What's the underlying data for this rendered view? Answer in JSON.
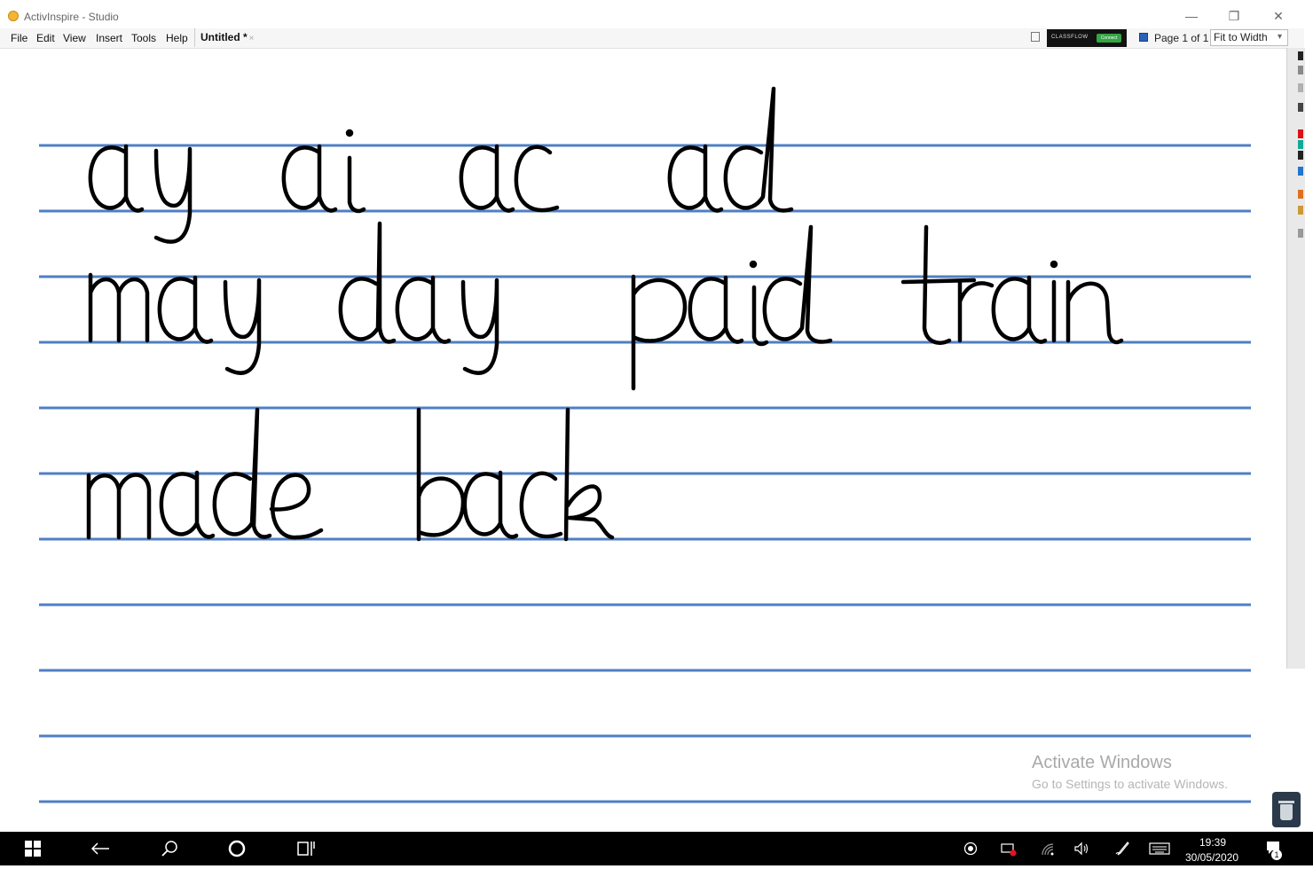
{
  "window": {
    "title": "ActivInspire - Studio",
    "minimize_glyph": "—",
    "maximize_glyph": "❐",
    "close_glyph": "✕"
  },
  "menu": {
    "items": [
      "File",
      "Edit",
      "View",
      "Insert",
      "Tools",
      "Help"
    ],
    "document_tab": "Untitled *",
    "document_tab_close": "×"
  },
  "toolbar": {
    "classflow_label": "CLASSFLOW",
    "classflow_button": "Connect",
    "page_indicator": "Page 1 of 1",
    "zoom": "Fit to Width",
    "zoom_arrow": "▾"
  },
  "canvas": {
    "handwritten_words": [
      [
        "ay",
        "ai",
        "ac",
        "ad"
      ],
      [
        "may",
        "day",
        "paid",
        "train"
      ],
      [
        "made",
        "back"
      ]
    ],
    "line_color": "#4f7fc4"
  },
  "watermark": {
    "title": "Activate Windows",
    "subtitle": "Go to Settings to activate Windows."
  },
  "taskbar": {
    "clock_time": "19:39",
    "clock_date": "30/05/2020",
    "notification_count": "1",
    "icons": [
      "windows-start-icon",
      "back-arrow-icon",
      "search-icon",
      "cortana-circle-icon",
      "task-view-icon",
      "record-icon",
      "network-error-icon",
      "wifi-icon",
      "volume-icon",
      "pen-icon",
      "keyboard-icon",
      "notification-icon"
    ]
  }
}
